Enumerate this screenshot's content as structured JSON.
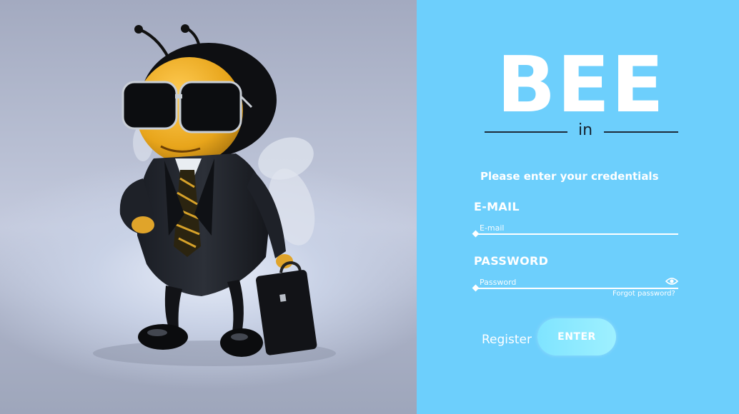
{
  "brand": {
    "logo": "BEE",
    "subtitle": "in"
  },
  "form": {
    "instructions": "Please enter your credentials",
    "email_label": "E-MAIL",
    "email_placeholder": "E-mail",
    "password_label": "PASSWORD",
    "password_placeholder": "Password",
    "forgot_password": "Forgot password?",
    "register_label": "Register",
    "enter_label": "ENTER"
  },
  "illustration": {
    "subject": "bee-in-business-suit-icon"
  },
  "colors": {
    "panel_bg": "#6dcffc",
    "text": "#ffffff",
    "button": "#8eeaff"
  }
}
